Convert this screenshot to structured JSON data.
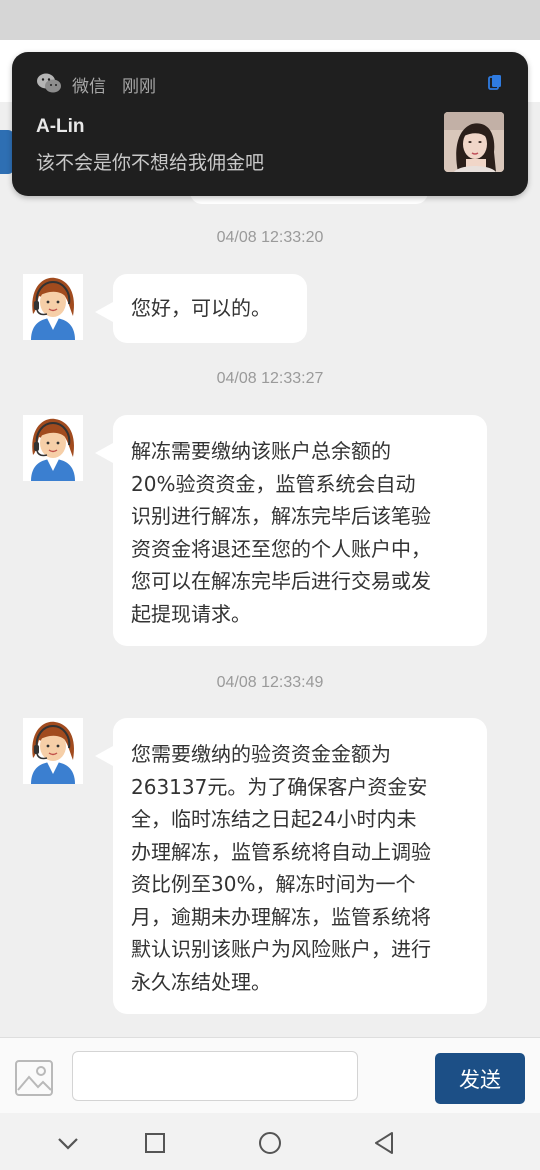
{
  "notification": {
    "app_name": "微信",
    "time": "刚刚",
    "sender": "A-Lin",
    "message": "该不会是你不想给我佣金吧"
  },
  "chat": {
    "messages": [
      {
        "timestamp": "04/08 12:33:20",
        "lines": [
          "您好，可以的。"
        ]
      },
      {
        "timestamp": "04/08 12:33:27",
        "lines": [
          "解冻需要缴纳该账户总余额的",
          "20%验资资金，监管系统会自动",
          "识别进行解冻，解冻完毕后该笔验",
          "资资金将退还至您的个人账户中，",
          "您可以在解冻完毕后进行交易或发",
          "起提现请求。"
        ]
      },
      {
        "timestamp": "04/08 12:33:49",
        "lines": [
          "您需要缴纳的验资资金金额为",
          "263137元。为了确保客户资金安",
          "全，临时冻结之日起24小时内未",
          "办理解冻，监管系统将自动上调验",
          "资比例至30%，解冻时间为一个",
          "月，逾期未办理解冻，监管系统将",
          "默认识别该账户为风险账户，进行",
          "永久冻结处理。"
        ]
      }
    ]
  },
  "input_bar": {
    "placeholder": "",
    "send_label": "发送",
    "image_icon": "image-icon"
  },
  "nav": {
    "icons": [
      "chevron-down-icon",
      "square-recents-icon",
      "circle-home-icon",
      "triangle-back-icon"
    ]
  },
  "colors": {
    "send_button": "#1c4f86",
    "notification_bg": "#1f1f1f",
    "accent_blue": "#2e6fb3"
  }
}
